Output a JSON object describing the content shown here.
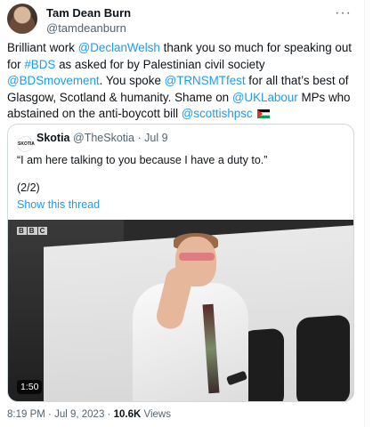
{
  "author": {
    "display_name": "Tam Dean Burn",
    "handle": "@tamdeanburn"
  },
  "more_icon": "more-horizontal-icon",
  "tweet": {
    "t1": "Brilliant work ",
    "m1": "@DeclanWelsh",
    "t2": " thank you so much for speaking out for ",
    "h1": "#BDS",
    "t3": " as asked for by Palestinian civil society ",
    "m2": "@BDSmovement",
    "t4": ". You spoke ",
    "m3": "@TRNSMTfest",
    "t5": " for all that’s best of Glasgow, Scotland & humanity. Shame on ",
    "m4": "@UKLabour",
    "t6": " MPs who abstained on the anti-boycott bill ",
    "m5": "@scottishpsc",
    "flag_icon": "palestine-flag-icon"
  },
  "quote": {
    "avatar_text": "SKOTIA",
    "name": "Skotia",
    "handle": "@TheSkotia",
    "separator": "·",
    "date": "Jul 9",
    "text": "“I am here talking to you because I have a duty to.”",
    "part": "(2/2)",
    "show_thread": "Show this thread",
    "video": {
      "watermark": [
        "B",
        "B",
        "C"
      ],
      "duration": "1:50"
    }
  },
  "meta": {
    "time": "8:19 PM",
    "dot": "·",
    "date": "Jul 9, 2023",
    "dot2": "·",
    "views_count": "10.6K",
    "views_label": "Views"
  },
  "colors": {
    "link": "#1d9bf0",
    "text": "#0f1419",
    "secondary": "#536471",
    "border": "#cfd9de"
  }
}
